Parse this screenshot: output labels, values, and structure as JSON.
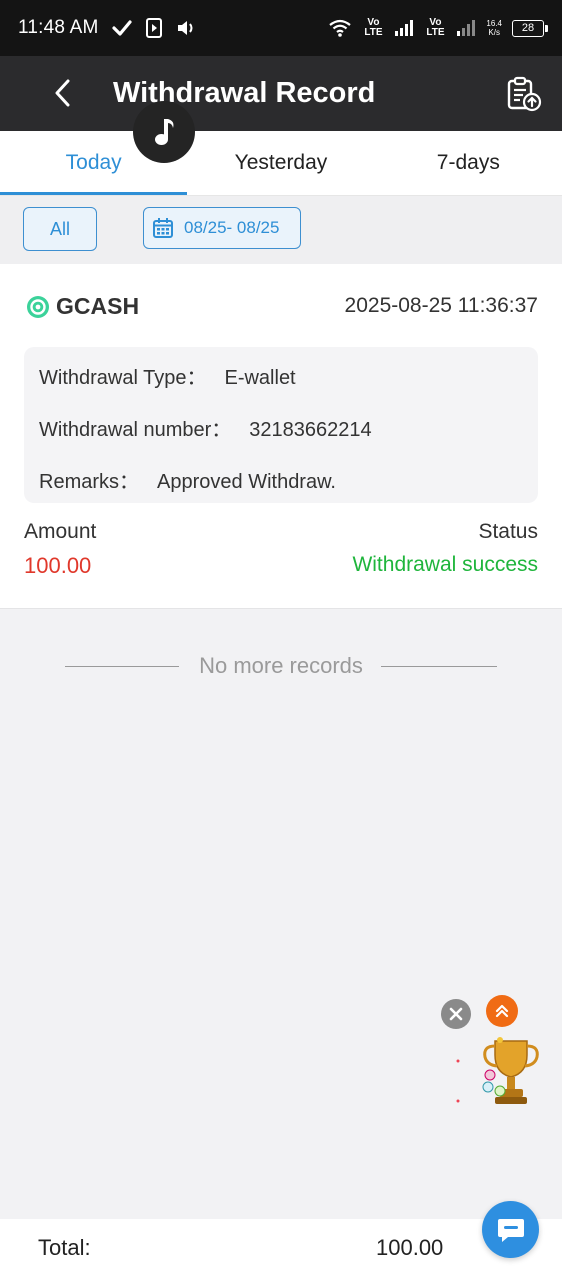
{
  "status_bar": {
    "time": "11:48 AM",
    "net_speed_top": "16.4",
    "net_speed_bottom": "K/s",
    "sim1": "Vo LTE",
    "sim2": "Vo LTE",
    "battery": "28"
  },
  "header": {
    "title": "Withdrawal Record"
  },
  "tabs": [
    {
      "label": "Today",
      "active": true
    },
    {
      "label": "Yesterday",
      "active": false
    },
    {
      "label": "7-days",
      "active": false
    }
  ],
  "filters": {
    "all_label": "All",
    "date_range": "08/25- 08/25"
  },
  "record": {
    "brand": "GCASH",
    "datetime": "2025-08-25 11:36:37",
    "type_label": "Withdrawal Type：",
    "type_value": "E-wallet",
    "number_label": "Withdrawal number：",
    "number_value": "32183662214",
    "remarks_label": "Remarks：",
    "remarks_value": "Approved Withdraw.",
    "amount_label": "Amount",
    "amount_value": "100.00",
    "status_label": "Status",
    "status_value": "Withdrawal success"
  },
  "list_end_text": "No more records",
  "footer": {
    "total_label": "Total:",
    "total_value": "100.00"
  },
  "colors": {
    "accent": "#2e8fd6",
    "header_bg": "#2b2b2d",
    "amount": "#e0382b",
    "success": "#1fb53c"
  }
}
